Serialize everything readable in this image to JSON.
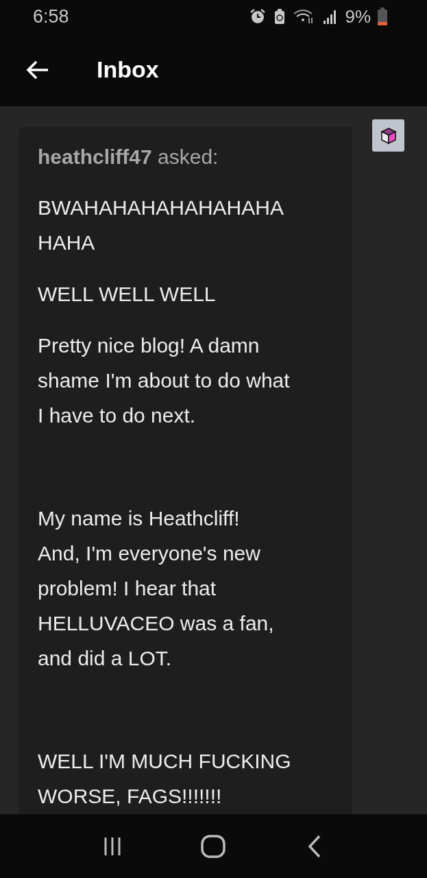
{
  "status_bar": {
    "time": "6:58",
    "battery": "9%"
  },
  "header": {
    "title": "Inbox"
  },
  "question": {
    "asker": "heathcliff47",
    "verb": "asked:",
    "paragraphs": [
      {
        "lines": [
          "BWAHAHAHAHAHAHAHA",
          "HAHA"
        ],
        "blank_after": false
      },
      {
        "lines": [
          "WELL WELL WELL"
        ],
        "blank_after": false
      },
      {
        "lines": [
          "Pretty nice blog! A damn",
          "shame I'm about to do what",
          "I have to do next."
        ],
        "blank_after": true
      },
      {
        "lines": [
          "My name is Heathcliff!",
          "And, I'm everyone's new",
          "problem! I hear that",
          "HELLUVACEO was a fan,",
          "and did a LOT."
        ],
        "blank_after": true
      },
      {
        "lines": [
          "WELL I'M MUCH FUCKING",
          "WORSE, FAGS!!!!!!!"
        ],
        "blank_after": false
      }
    ]
  }
}
